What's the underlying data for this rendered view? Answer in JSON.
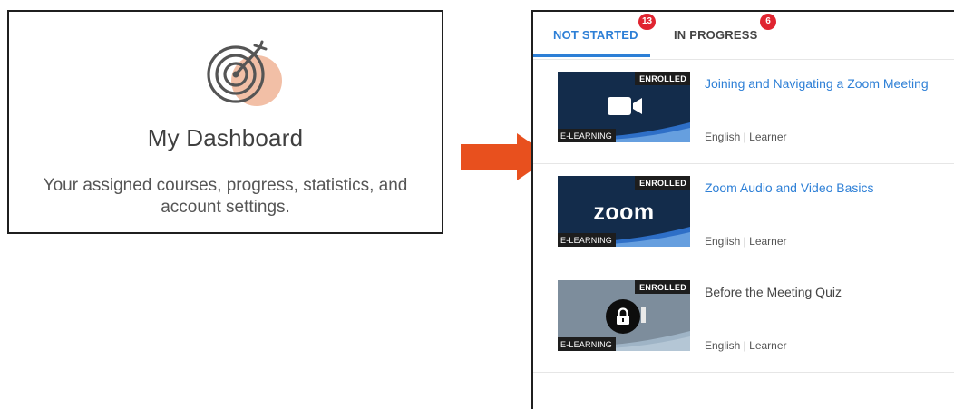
{
  "dashboard": {
    "icon": "target-dart-icon",
    "title": "My Dashboard",
    "description_line1": "Your assigned courses, progress, statistics, and",
    "description_line2": "account settings."
  },
  "arrow": {
    "icon": "arrow-right-icon",
    "color": "#e8501e"
  },
  "tabs": [
    {
      "label": "NOT STARTED",
      "count": "13",
      "active": true
    },
    {
      "label": "IN PROGRESS",
      "count": "6",
      "active": false
    }
  ],
  "courses": [
    {
      "title": "Joining and Navigating a Zoom Meeting",
      "status": "ENROLLED",
      "type": "E-LEARNING",
      "meta": "English | Learner",
      "thumbnail_icon": "video-camera-icon"
    },
    {
      "title": "Zoom Audio and Video Basics",
      "status": "ENROLLED",
      "type": "E-LEARNING",
      "meta": "English | Learner",
      "thumbnail_logo": "zoom"
    },
    {
      "title": "Before the Meeting Quiz",
      "status": "ENROLLED",
      "type": "E-LEARNING",
      "meta": "English | Learner",
      "thumbnail_icon": "lock-icon",
      "locked": true
    }
  ],
  "colors": {
    "accent": "#2d7fd6",
    "badge": "#e02430",
    "thumb_dark": "#132c4b",
    "thumb_locked": "#7d8d9c",
    "wave": "#2e6fc7",
    "arrow": "#e8501e"
  }
}
